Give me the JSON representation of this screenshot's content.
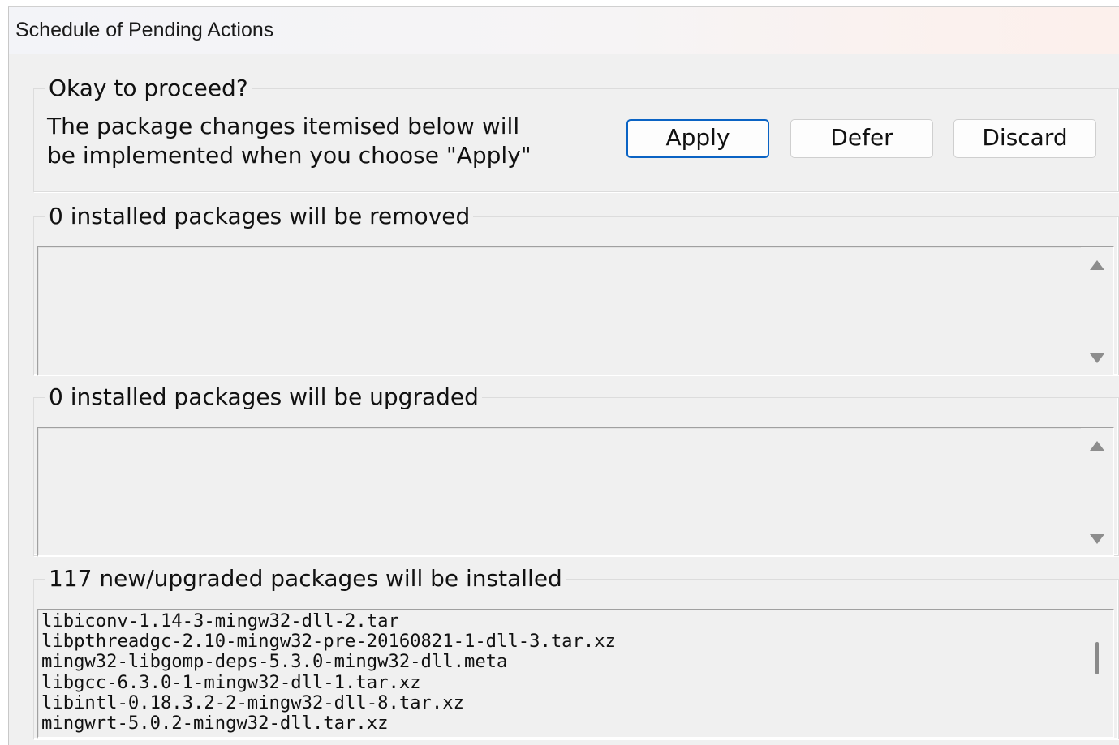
{
  "window": {
    "title": "Schedule of Pending Actions"
  },
  "proceed": {
    "legend": "Okay to proceed?",
    "line1": "The package changes itemised below will",
    "line2": "be implemented when you choose \"Apply\"",
    "apply_label": "Apply",
    "defer_label": "Defer",
    "discard_label": "Discard"
  },
  "removed": {
    "legend": "0 installed packages will be removed",
    "items": []
  },
  "upgraded": {
    "legend": "0 installed packages will be upgraded",
    "items": []
  },
  "installed": {
    "legend": "117 new/upgraded packages will be installed",
    "items": [
      "libiconv-1.14-3-mingw32-dll-2.tar",
      "libpthreadgc-2.10-mingw32-pre-20160821-1-dll-3.tar.xz",
      "mingw32-libgomp-deps-5.3.0-mingw32-dll.meta",
      "libgcc-6.3.0-1-mingw32-dll-1.tar.xz",
      "libintl-0.18.3.2-2-mingw32-dll-8.tar.xz",
      "mingwrt-5.0.2-mingw32-dll.tar.xz"
    ]
  },
  "colors": {
    "accent": "#0a63c4",
    "window_bg": "#f0f0f0",
    "scroll_arrow": "#8d8d8d"
  },
  "icons": [
    "scroll-up-arrow-icon",
    "scroll-down-arrow-icon"
  ]
}
